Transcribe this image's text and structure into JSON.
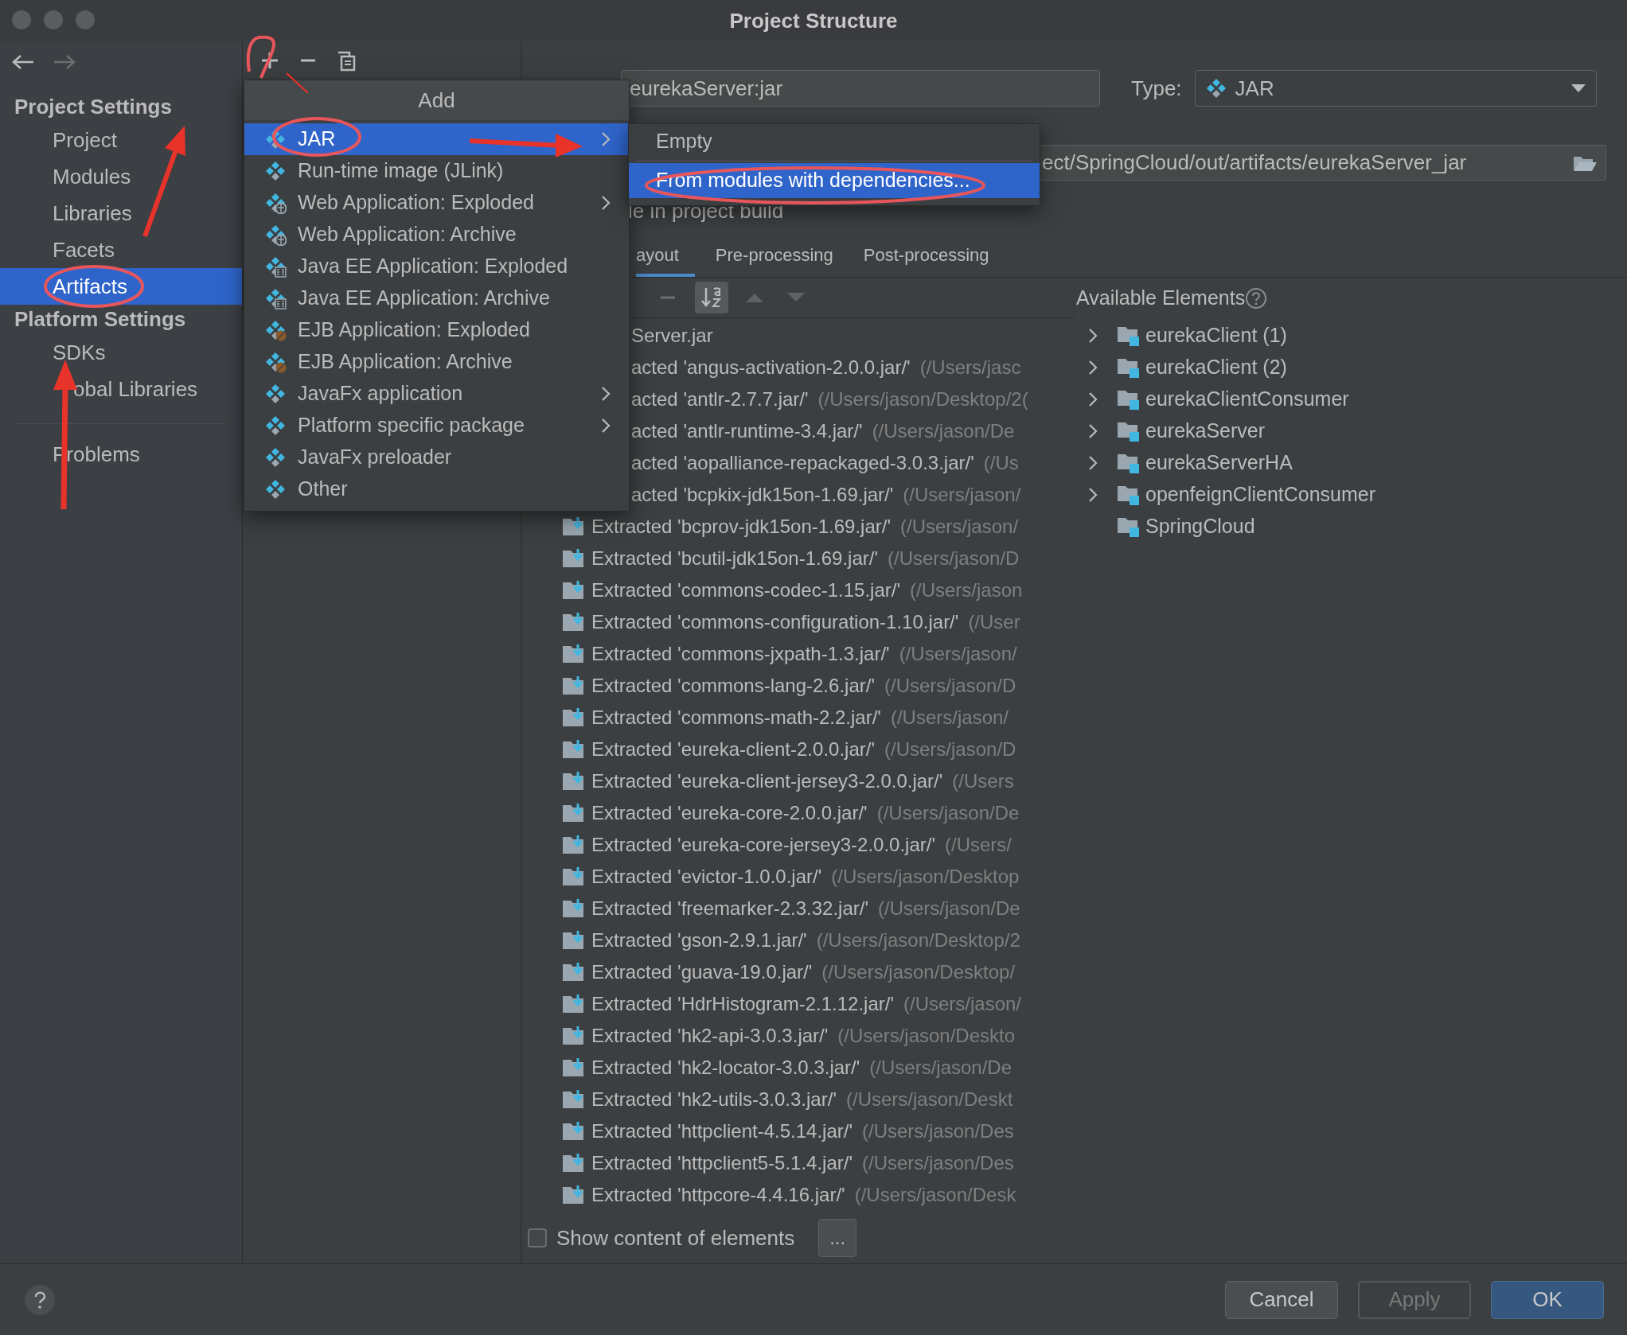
{
  "window": {
    "title": "Project Structure"
  },
  "sidebar": {
    "sections": [
      {
        "heading": "Project Settings",
        "items": [
          {
            "label": "Project",
            "selected": false
          },
          {
            "label": "Modules",
            "selected": false
          },
          {
            "label": "Libraries",
            "selected": false
          },
          {
            "label": "Facets",
            "selected": false
          },
          {
            "label": "Artifacts",
            "selected": true
          }
        ]
      },
      {
        "heading": "Platform Settings",
        "items": [
          {
            "label": "SDKs",
            "selected": false
          },
          {
            "label": "obal Libraries",
            "kind": "covered",
            "selected": false
          }
        ]
      }
    ],
    "bottom_items": [
      {
        "label": "Problems",
        "selected": false
      }
    ]
  },
  "add_menu": {
    "title": "Add",
    "items": [
      {
        "label": "JAR",
        "kind": "plain",
        "submenu": true,
        "selected": true
      },
      {
        "label": "Run-time image (JLink)",
        "kind": "plain",
        "submenu": false,
        "selected": false
      },
      {
        "label": "Web Application: Exploded",
        "kind": "web",
        "submenu": true,
        "selected": false
      },
      {
        "label": "Web Application: Archive",
        "kind": "web",
        "submenu": false,
        "selected": false
      },
      {
        "label": "Java EE Application: Exploded",
        "kind": "ee",
        "submenu": false,
        "selected": false
      },
      {
        "label": "Java EE Application: Archive",
        "kind": "ee",
        "submenu": false,
        "selected": false
      },
      {
        "label": "EJB Application: Exploded",
        "kind": "ejb",
        "submenu": false,
        "selected": false
      },
      {
        "label": "EJB Application: Archive",
        "kind": "ejb",
        "submenu": false,
        "selected": false
      },
      {
        "label": "JavaFx application",
        "kind": "plain",
        "submenu": true,
        "selected": false
      },
      {
        "label": "Platform specific package",
        "kind": "plain",
        "submenu": true,
        "selected": false
      },
      {
        "label": "JavaFx preloader",
        "kind": "plain",
        "submenu": false,
        "selected": false
      },
      {
        "label": "Other",
        "kind": "plain",
        "submenu": false,
        "selected": false
      }
    ]
  },
  "jar_submenu": {
    "items": [
      {
        "label": "Empty",
        "selected": false
      },
      {
        "label": "From modules with dependencies...",
        "selected": true
      }
    ]
  },
  "artifact": {
    "name": "eurekaServer:jar",
    "type_label": "Type:",
    "type": "JAR",
    "output_directory": "ect/SpringCloud/out/artifacts/eurekaServer_jar",
    "include_text": "le in project build"
  },
  "tabs": [
    {
      "label": "ayout",
      "selected": true
    },
    {
      "label": "Pre-processing",
      "selected": false
    },
    {
      "label": "Post-processing",
      "selected": false
    }
  ],
  "layout_tree": [
    {
      "kind": "covered",
      "name": "Server.jar"
    },
    {
      "kind": "covered",
      "name": "acted 'angus-activation-2.0.0.jar/'",
      "path": "(/Users/jasc"
    },
    {
      "kind": "covered",
      "name": "acted 'antlr-2.7.7.jar/'",
      "path": "(/Users/jason/Desktop/2("
    },
    {
      "kind": "covered",
      "name": "acted 'antlr-runtime-3.4.jar/'",
      "path": "(/Users/jason/De"
    },
    {
      "kind": "covered",
      "name": "acted 'aopalliance-repackaged-3.0.3.jar/'",
      "path": "(/Us"
    },
    {
      "kind": "covered",
      "name": "acted 'bcpkix-jdk15on-1.69.jar/'",
      "path": "(/Users/jason/"
    },
    {
      "kind": "extracted",
      "name": "Extracted 'bcprov-jdk15on-1.69.jar/'",
      "path": "(/Users/jason/"
    },
    {
      "kind": "extracted",
      "name": "Extracted 'bcutil-jdk15on-1.69.jar/'",
      "path": "(/Users/jason/D"
    },
    {
      "kind": "extracted",
      "name": "Extracted 'commons-codec-1.15.jar/'",
      "path": "(/Users/jason"
    },
    {
      "kind": "extracted",
      "name": "Extracted 'commons-configuration-1.10.jar/'",
      "path": "(/User"
    },
    {
      "kind": "extracted",
      "name": "Extracted 'commons-jxpath-1.3.jar/'",
      "path": "(/Users/jason/"
    },
    {
      "kind": "extracted",
      "name": "Extracted 'commons-lang-2.6.jar/'",
      "path": "(/Users/jason/D"
    },
    {
      "kind": "extracted",
      "name": "Extracted 'commons-math-2.2.jar/'",
      "path": "(/Users/jason/"
    },
    {
      "kind": "extracted",
      "name": "Extracted 'eureka-client-2.0.0.jar/'",
      "path": "(/Users/jason/D"
    },
    {
      "kind": "extracted",
      "name": "Extracted 'eureka-client-jersey3-2.0.0.jar/'",
      "path": "(/Users"
    },
    {
      "kind": "extracted",
      "name": "Extracted 'eureka-core-2.0.0.jar/'",
      "path": "(/Users/jason/De"
    },
    {
      "kind": "extracted",
      "name": "Extracted 'eureka-core-jersey3-2.0.0.jar/'",
      "path": "(/Users/"
    },
    {
      "kind": "extracted",
      "name": "Extracted 'evictor-1.0.0.jar/'",
      "path": "(/Users/jason/Desktop"
    },
    {
      "kind": "extracted",
      "name": "Extracted 'freemarker-2.3.32.jar/'",
      "path": "(/Users/jason/De"
    },
    {
      "kind": "extracted",
      "name": "Extracted 'gson-2.9.1.jar/'",
      "path": "(/Users/jason/Desktop/2"
    },
    {
      "kind": "extracted",
      "name": "Extracted 'guava-19.0.jar/'",
      "path": "(/Users/jason/Desktop/"
    },
    {
      "kind": "extracted",
      "name": "Extracted 'HdrHistogram-2.1.12.jar/'",
      "path": "(/Users/jason/"
    },
    {
      "kind": "extracted",
      "name": "Extracted 'hk2-api-3.0.3.jar/'",
      "path": "(/Users/jason/Deskto"
    },
    {
      "kind": "extracted",
      "name": "Extracted 'hk2-locator-3.0.3.jar/'",
      "path": "(/Users/jason/De"
    },
    {
      "kind": "extracted",
      "name": "Extracted 'hk2-utils-3.0.3.jar/'",
      "path": "(/Users/jason/Deskt"
    },
    {
      "kind": "extracted",
      "name": "Extracted 'httpclient-4.5.14.jar/'",
      "path": "(/Users/jason/Des"
    },
    {
      "kind": "extracted",
      "name": "Extracted 'httpclient5-5.1.4.jar/'",
      "path": "(/Users/jason/Des"
    },
    {
      "kind": "extracted",
      "name": "Extracted 'httpcore-4.4.16.jar/'",
      "path": "(/Users/jason/Desk"
    }
  ],
  "available_elements": {
    "title": "Available Elements",
    "items": [
      {
        "label": "eurekaClient (1)",
        "expandable": true
      },
      {
        "label": "eurekaClient (2)",
        "expandable": true
      },
      {
        "label": "eurekaClientConsumer",
        "expandable": true
      },
      {
        "label": "eurekaServer",
        "expandable": true
      },
      {
        "label": "eurekaServerHA",
        "expandable": true
      },
      {
        "label": "openfeignClientConsumer",
        "expandable": true
      },
      {
        "label": "SpringCloud",
        "expandable": false
      }
    ]
  },
  "show_content": {
    "label": "Show content of elements",
    "checked": false
  },
  "more_button": "...",
  "footer": {
    "buttons": [
      {
        "label": "Cancel",
        "kind": "normal",
        "disabled": false
      },
      {
        "label": "Apply",
        "kind": "normal",
        "disabled": true
      },
      {
        "label": "OK",
        "kind": "default",
        "disabled": false
      }
    ]
  }
}
